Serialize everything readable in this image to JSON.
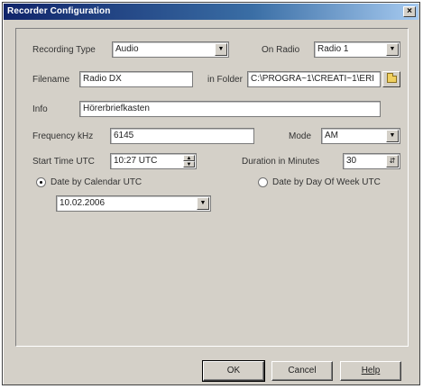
{
  "window": {
    "title": "Recorder Configuration"
  },
  "form": {
    "recording_type": {
      "label": "Recording Type",
      "value": "Audio"
    },
    "on_radio": {
      "label": "On Radio",
      "value": "Radio 1"
    },
    "filename": {
      "label": "Filename",
      "value": "Radio DX"
    },
    "in_folder": {
      "label": "in Folder",
      "value": "C:\\PROGRA~1\\CREATI~1\\ERI"
    },
    "info": {
      "label": "Info",
      "value": "Hörerbriefkasten"
    },
    "frequency": {
      "label": "Frequency kHz",
      "value": "6145"
    },
    "mode": {
      "label": "Mode",
      "value": "AM"
    },
    "start_time": {
      "label": "Start Time UTC",
      "value": "10:27 UTC"
    },
    "duration": {
      "label": "Duration in Minutes",
      "value": "30"
    },
    "date_by_calendar": {
      "label": "Date by Calendar UTC",
      "checked": true
    },
    "date_by_day_of_week": {
      "label": "Date by Day Of Week UTC",
      "checked": false
    },
    "date": {
      "value": "10.02.2006"
    }
  },
  "buttons": {
    "ok": "OK",
    "cancel": "Cancel",
    "help": "Help"
  }
}
